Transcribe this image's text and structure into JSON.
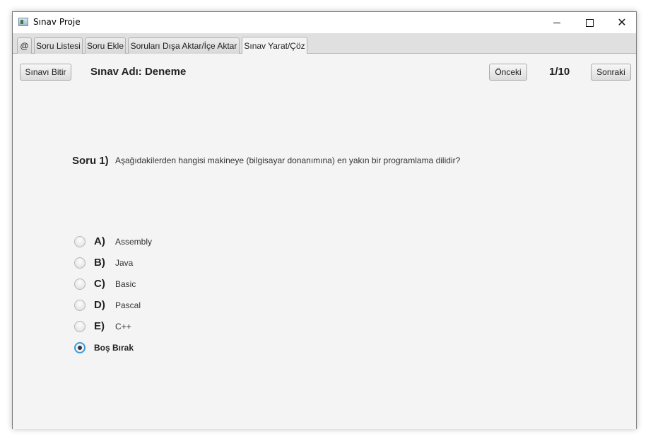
{
  "window": {
    "title": "Sınav Proje",
    "controls": {
      "minimize_icon": "minimize-icon",
      "maximize_icon": "maximize-icon",
      "close_glyph": "✕"
    }
  },
  "tabs": [
    {
      "label": "@",
      "active": false
    },
    {
      "label": "Soru Listesi",
      "active": false
    },
    {
      "label": "Soru Ekle",
      "active": false
    },
    {
      "label": "Soruları Dışa Aktar/İçe Aktar",
      "active": false
    },
    {
      "label": "Sınav Yarat/Çöz",
      "active": true
    }
  ],
  "toolbar": {
    "finish_label": "Sınavı Bitir",
    "exam_name": "Sınav Adı: Deneme",
    "prev_label": "Önceki",
    "counter": "1/10",
    "next_label": "Sonraki"
  },
  "question": {
    "label": "Soru 1)",
    "text": "Aşağıdakilerden hangisi makineye (bilgisayar donanımına) en yakın bir programlama dilidir?"
  },
  "options": [
    {
      "letter": "A)",
      "text": "Assembly",
      "selected": false
    },
    {
      "letter": "B)",
      "text": "Java",
      "selected": false
    },
    {
      "letter": "C)",
      "text": "Basic",
      "selected": false
    },
    {
      "letter": "D)",
      "text": "Pascal",
      "selected": false
    },
    {
      "letter": "E)",
      "text": "C++",
      "selected": false
    }
  ],
  "blank_option": {
    "label": "Boş Bırak",
    "selected": true
  },
  "colors": {
    "accent": "#3c9ad8",
    "background": "#f4f4f4"
  }
}
